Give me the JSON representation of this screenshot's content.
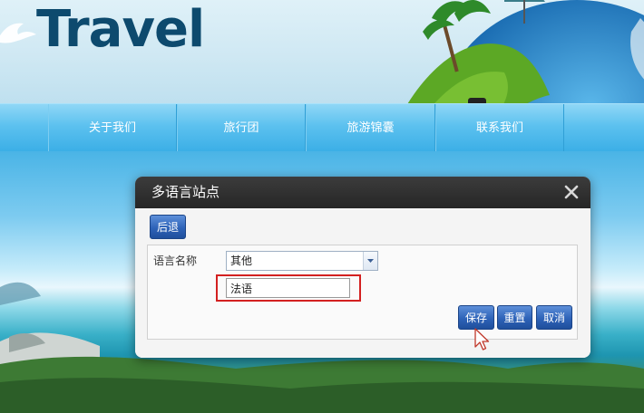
{
  "header": {
    "logo_text": "Travel"
  },
  "nav": {
    "items": [
      {
        "label": "关于我们"
      },
      {
        "label": "旅行团"
      },
      {
        "label": "旅游锦囊"
      },
      {
        "label": "联系我们"
      }
    ]
  },
  "dialog": {
    "title": "多语言站点",
    "back_button": "后退",
    "form": {
      "language_name_label": "语言名称",
      "language_select_value": "其他",
      "custom_language_value": "法语"
    },
    "actions": {
      "save": "保存",
      "reset": "重置",
      "cancel": "取消"
    }
  },
  "colors": {
    "nav_bg": "#3aaee6",
    "dialog_header": "#262626",
    "button_blue": "#2e63b8",
    "highlight_red": "#d32020",
    "logo_text": "#0d4a6e"
  },
  "icons": [
    "bird-logo-icon",
    "close-icon",
    "dropdown-arrow-icon",
    "mouse-cursor-icon"
  ]
}
